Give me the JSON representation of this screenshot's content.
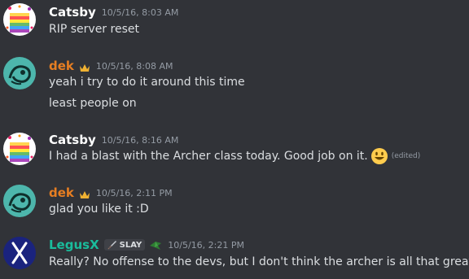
{
  "messages": [
    {
      "username": "Catsby",
      "username_color": "#ffffff",
      "timestamp": "10/5/16, 8:03 AM",
      "avatar": "rainbow-cake-avatar",
      "lines": [
        "RIP server reset"
      ]
    },
    {
      "username": "dek",
      "username_color": "#e67e22",
      "timestamp": "10/5/16, 8:08 AM",
      "avatar": "teal-creature-avatar",
      "badge_icon": "crown-icon",
      "lines": [
        "yeah i try to do it around this time",
        "least people on"
      ]
    },
    {
      "username": "Catsby",
      "username_color": "#ffffff",
      "timestamp": "10/5/16, 8:16 AM",
      "avatar": "rainbow-cake-avatar",
      "lines": [
        "I had a blast with the Archer class today. Good job on it."
      ],
      "emoji": "smiley-emoji",
      "edited_label": "(edited)"
    },
    {
      "username": "dek",
      "username_color": "#e67e22",
      "timestamp": "10/5/16, 2:11 PM",
      "avatar": "teal-creature-avatar",
      "badge_icon": "crown-icon",
      "lines": [
        "glad you like it :D"
      ]
    },
    {
      "username": "LegusX",
      "username_color": "#1abc9c",
      "timestamp": "10/5/16, 2:21 PM",
      "avatar": "blue-x-avatar",
      "tag_label": "SLAY",
      "tag_icon": "sword-icon",
      "role_icon": "green-bird-icon",
      "lines": [
        "Really? No offense to the devs, but I don't think the archer is all that great"
      ]
    }
  ]
}
